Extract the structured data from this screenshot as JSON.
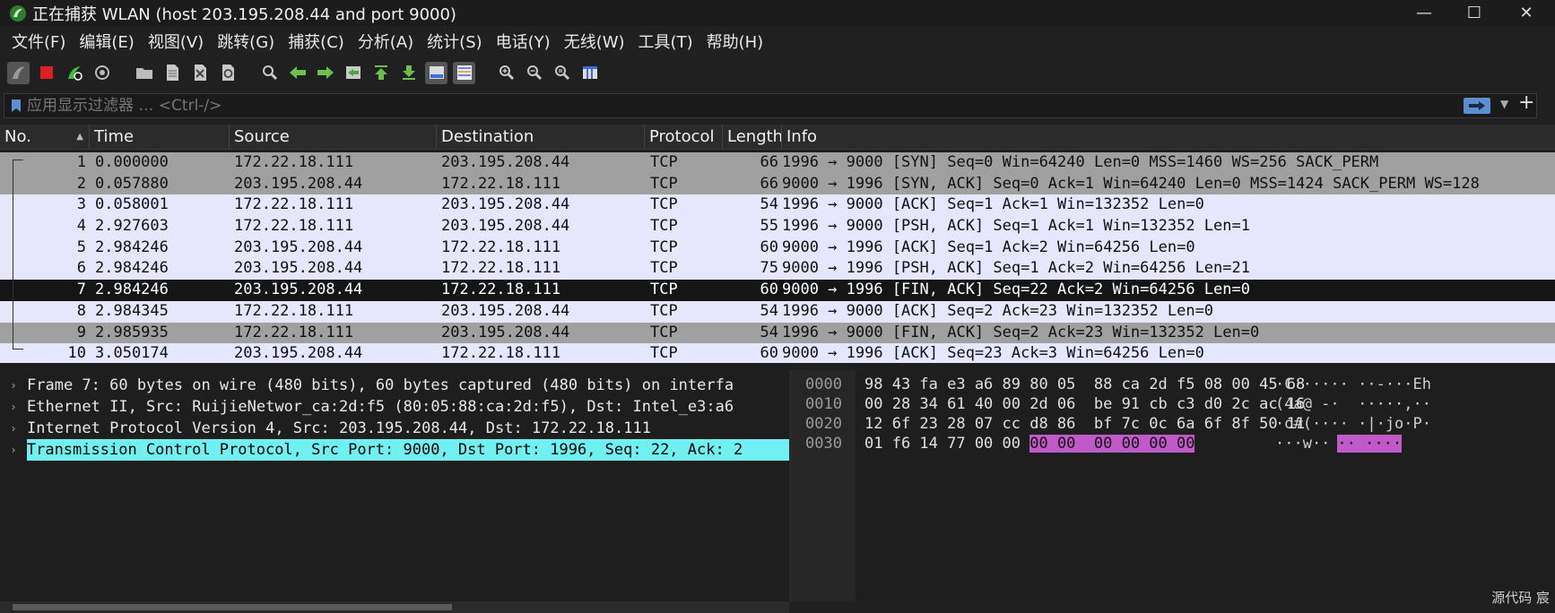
{
  "window": {
    "title": "正在捕获 WLAN (host 203.195.208.44 and port 9000)",
    "minimize": "—",
    "maximize": "☐",
    "close": "✕"
  },
  "menu": [
    "文件(F)",
    "编辑(E)",
    "视图(V)",
    "跳转(G)",
    "捕获(C)",
    "分析(A)",
    "统计(S)",
    "电话(Y)",
    "无线(W)",
    "工具(T)",
    "帮助(H)"
  ],
  "toolbar_icons": [
    "shark-fin-start-icon",
    "stop-capture-icon",
    "restart-capture-icon",
    "capture-options-icon",
    "open-folder-icon",
    "file-icon",
    "close-file-icon",
    "reload-icon",
    "find-packet-icon",
    "go-back-icon",
    "go-forward-icon",
    "go-to-packet-icon",
    "first-packet-icon",
    "last-packet-icon",
    "autoscroll-icon",
    "colorize-icon",
    "zoom-in-icon",
    "zoom-out-icon",
    "normal-size-icon",
    "resize-columns-icon"
  ],
  "filter": {
    "placeholder": "应用显示过滤器 … <Ctrl-/>",
    "apply_icon": "arrow-right-icon",
    "add_label": "+"
  },
  "columns": [
    "No.",
    "Time",
    "Source",
    "Destination",
    "Protocol",
    "Length",
    "Info"
  ],
  "packets": [
    {
      "no": "1",
      "time": "0.000000",
      "src": "172.22.18.111",
      "dst": "203.195.208.44",
      "proto": "TCP",
      "len": "66",
      "info": "1996 → 9000 [SYN] Seq=0 Win=64240 Len=0 MSS=1460 WS=256 SACK_PERM",
      "style": "grey"
    },
    {
      "no": "2",
      "time": "0.057880",
      "src": "203.195.208.44",
      "dst": "172.22.18.111",
      "proto": "TCP",
      "len": "66",
      "info": "9000 → 1996 [SYN, ACK] Seq=0 Ack=1 Win=64240 Len=0 MSS=1424 SACK_PERM WS=128",
      "style": "grey"
    },
    {
      "no": "3",
      "time": "0.058001",
      "src": "172.22.18.111",
      "dst": "203.195.208.44",
      "proto": "TCP",
      "len": "54",
      "info": "1996 → 9000 [ACK] Seq=1 Ack=1 Win=132352 Len=0",
      "style": "lav"
    },
    {
      "no": "4",
      "time": "2.927603",
      "src": "172.22.18.111",
      "dst": "203.195.208.44",
      "proto": "TCP",
      "len": "55",
      "info": "1996 → 9000 [PSH, ACK] Seq=1 Ack=1 Win=132352 Len=1",
      "style": "lav"
    },
    {
      "no": "5",
      "time": "2.984246",
      "src": "203.195.208.44",
      "dst": "172.22.18.111",
      "proto": "TCP",
      "len": "60",
      "info": "9000 → 1996 [ACK] Seq=1 Ack=2 Win=64256 Len=0",
      "style": "lav"
    },
    {
      "no": "6",
      "time": "2.984246",
      "src": "203.195.208.44",
      "dst": "172.22.18.111",
      "proto": "TCP",
      "len": "75",
      "info": "9000 → 1996 [PSH, ACK] Seq=1 Ack=2 Win=64256 Len=21",
      "style": "lav"
    },
    {
      "no": "7",
      "time": "2.984246",
      "src": "203.195.208.44",
      "dst": "172.22.18.111",
      "proto": "TCP",
      "len": "60",
      "info": "9000 → 1996 [FIN, ACK] Seq=22 Ack=2 Win=64256 Len=0",
      "style": "sel"
    },
    {
      "no": "8",
      "time": "2.984345",
      "src": "172.22.18.111",
      "dst": "203.195.208.44",
      "proto": "TCP",
      "len": "54",
      "info": "1996 → 9000 [ACK] Seq=2 Ack=23 Win=132352 Len=0",
      "style": "lav"
    },
    {
      "no": "9",
      "time": "2.985935",
      "src": "172.22.18.111",
      "dst": "203.195.208.44",
      "proto": "TCP",
      "len": "54",
      "info": "1996 → 9000 [FIN, ACK] Seq=2 Ack=23 Win=132352 Len=0",
      "style": "grey"
    },
    {
      "no": "10",
      "time": "3.050174",
      "src": "203.195.208.44",
      "dst": "172.22.18.111",
      "proto": "TCP",
      "len": "60",
      "info": "9000 → 1996 [ACK] Seq=23 Ack=3 Win=64256 Len=0",
      "style": "lav"
    }
  ],
  "details": [
    {
      "text": "Frame 7: 60 bytes on wire (480 bits), 60 bytes captured (480 bits) on interfa",
      "highlight": false
    },
    {
      "text": "Ethernet II, Src: RuijieNetwor_ca:2d:f5 (80:05:88:ca:2d:f5), Dst: Intel_e3:a6",
      "highlight": false
    },
    {
      "text": "Internet Protocol Version 4, Src: 203.195.208.44, Dst: 172.22.18.111",
      "highlight": false
    },
    {
      "text": "Transmission Control Protocol, Src Port: 9000, Dst Port: 1996, Seq: 22, Ack: 2",
      "highlight": true
    }
  ],
  "bytes": [
    {
      "offset": "0000",
      "hex": "98 43 fa e3 a6 89 80 05  88 ca 2d f5 08 00 45 68",
      "hex_hl": "",
      "ascii": "·C······ ··-···Eh",
      "ascii_hl": ""
    },
    {
      "offset": "0010",
      "hex": "00 28 34 61 40 00 2d 06  be 91 cb c3 d0 2c ac 16",
      "hex_hl": "",
      "ascii": "(4a@ -·  ·····,··",
      "ascii_hl": ""
    },
    {
      "offset": "0020",
      "hex": "12 6f 23 28 07 cc d8 86  bf 7c 0c 6a 6f 8f 50 11",
      "hex_hl": "",
      "ascii": "·o#(···· ·|·jo·P·",
      "ascii_hl": ""
    },
    {
      "offset": "0030",
      "hex": "01 f6 14 77 00 00 ",
      "hex_hl": "00 00  00 00 00 00",
      "ascii": "···w··",
      "ascii_hl": "·· ····"
    }
  ],
  "status_text": "源代码 宸"
}
